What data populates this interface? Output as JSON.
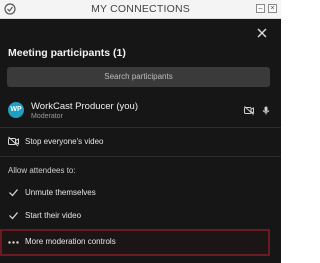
{
  "window": {
    "title": "MY CONNECTIONS",
    "minimize_icon": "minimize-icon",
    "close_icon": "window-close-icon"
  },
  "panel": {
    "close_icon": "close-icon",
    "heading": "Meeting participants (1)",
    "search_placeholder": "Search participants"
  },
  "participant": {
    "initials": "WP",
    "name": "WorkCast Producer (you)",
    "role": "Moderator",
    "avatar_color": "#1e9fc4",
    "icons": [
      "video-off-icon",
      "microphone-icon"
    ]
  },
  "actions": {
    "stop_video": "Stop everyone's video",
    "allow_heading": "Allow attendees to:",
    "unmute": "Unmute themselves",
    "start_video": "Start their video",
    "more": "More moderation controls"
  },
  "colors": {
    "panel_bg": "#161616",
    "search_bg": "#3a3a3a",
    "highlight_border": "#6b1a22"
  }
}
